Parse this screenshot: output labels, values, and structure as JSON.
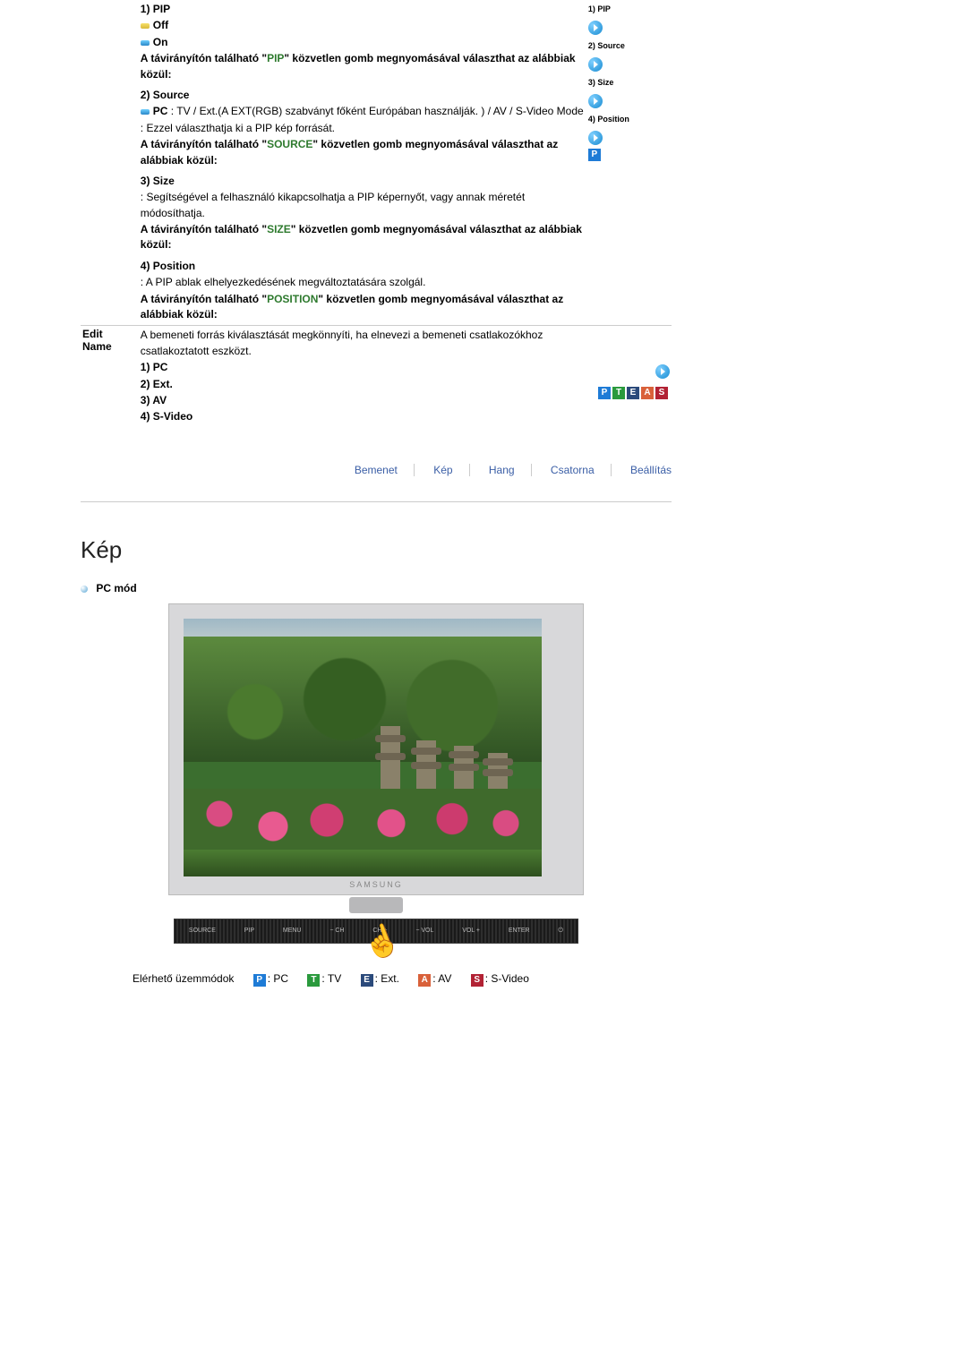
{
  "pip_section": {
    "row1": {
      "title": "1) PIP",
      "off": "Off",
      "on": "On",
      "remote_prefix": "A távirányítón található \"",
      "remote_keyword": "PIP",
      "remote_suffix": "\" közvetlen gomb megnyomásával választhat az alábbiak közül:"
    },
    "row2": {
      "title": "2) Source",
      "pc_label": "PC",
      "pc_text": " : TV / Ext.(A EXT(RGB) szabványt főként Európában használják. ) / AV / S-Video Mode",
      "desc": ": Ezzel választhatja ki a PIP kép forrását.",
      "remote_prefix": "A távirányítón található \"",
      "remote_keyword": "SOURCE",
      "remote_suffix": "\" közvetlen gomb megnyomásával választhat az alábbiak közül:"
    },
    "row3": {
      "title": "3) Size",
      "desc": ": Segítségével a felhasználó kikapcsolhatja a PIP képernyőt, vagy annak méretét módosíthatja.",
      "remote_prefix": "A távirányítón található \"",
      "remote_keyword": "SIZE",
      "remote_suffix": "\" közvetlen gomb megnyomásával választhat az alábbiak közül:"
    },
    "row4": {
      "title": "4) Position",
      "desc": ": A PIP ablak elhelyezkedésének megváltoztatására szolgál.",
      "remote_prefix": "A távirányítón található \"",
      "remote_keyword": "POSITION",
      "remote_suffix": "\" közvetlen gomb megnyomásával választhat az alábbiak közül:"
    },
    "right_labels": {
      "l1": "1) PIP",
      "l2": "2) Source",
      "l3": "3) Size",
      "l4": "4) Position"
    }
  },
  "editname": {
    "left_line1": "Edit",
    "left_line2": "Name",
    "desc": "A bemeneti forrás kiválasztását megkönnyíti, ha elnevezi a bemeneti csatlakozókhoz csatlakoztatott eszközt.",
    "item1": "1) PC",
    "item2": "2) Ext.",
    "item3": "3) AV",
    "item4": "4) S-Video"
  },
  "nav": {
    "n1": "Bemenet",
    "n2": "Kép",
    "n3": "Hang",
    "n4": "Csatorna",
    "n5": "Beállítás"
  },
  "kep": {
    "heading": "Kép",
    "pc_mode": "PC mód",
    "brand": "SAMSUNG",
    "buttons": {
      "b1": "SOURCE",
      "b2": "PIP",
      "b3": "MENU",
      "b4": "− CH",
      "b5": "CH +",
      "b6": "− VOL",
      "b7": "VOL +",
      "b8": "ENTER",
      "b9": "⏻"
    },
    "modes_label": "Elérhető üzemmódok",
    "modes": {
      "pc": ": PC",
      "tv": ": TV",
      "ext": ": Ext.",
      "av": ": AV",
      "sv": ": S-Video"
    },
    "badges": {
      "p": "P",
      "t": "T",
      "e": "E",
      "a": "A",
      "s": "S"
    }
  }
}
